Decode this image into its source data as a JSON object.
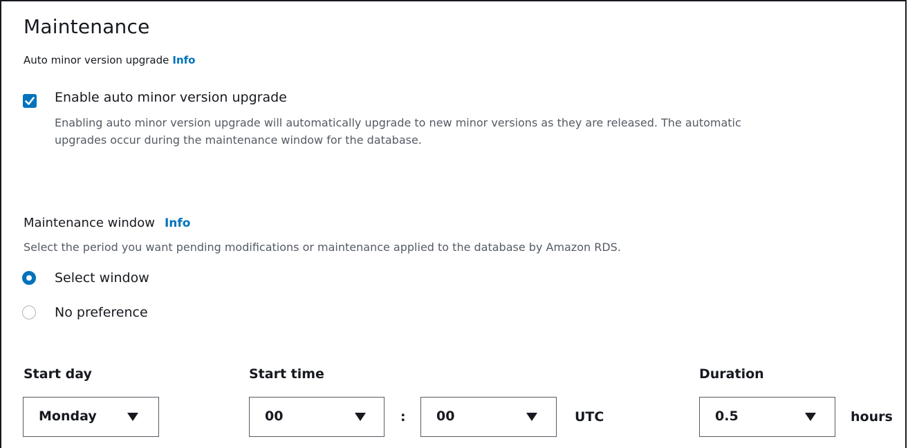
{
  "section": {
    "title": "Maintenance"
  },
  "auto_upgrade": {
    "label": "Auto minor version upgrade",
    "info_link": "Info",
    "checkbox_checked": true,
    "checkbox_label": "Enable auto minor version upgrade",
    "description": "Enabling auto minor version upgrade will automatically upgrade to new minor versions as they are released. The automatic upgrades occur during the maintenance window for the database."
  },
  "maintenance_window": {
    "label": "Maintenance window",
    "info_link": "Info",
    "description": "Select the period you want pending modifications or maintenance applied to the database by Amazon RDS.",
    "options": [
      {
        "label": "Select window",
        "selected": true
      },
      {
        "label": "No preference",
        "selected": false
      }
    ]
  },
  "start_day": {
    "label": "Start day",
    "value": "Monday"
  },
  "start_time": {
    "label": "Start time",
    "hour": "00",
    "separator": ":",
    "minute": "00",
    "timezone": "UTC"
  },
  "duration": {
    "label": "Duration",
    "value": "0.5",
    "unit": "hours"
  },
  "colors": {
    "accent": "#0073bb",
    "text": "#16191f",
    "muted": "#545b64"
  },
  "icons": {
    "checkbox": "checkmark-icon",
    "dropdown": "caret-down-icon"
  }
}
